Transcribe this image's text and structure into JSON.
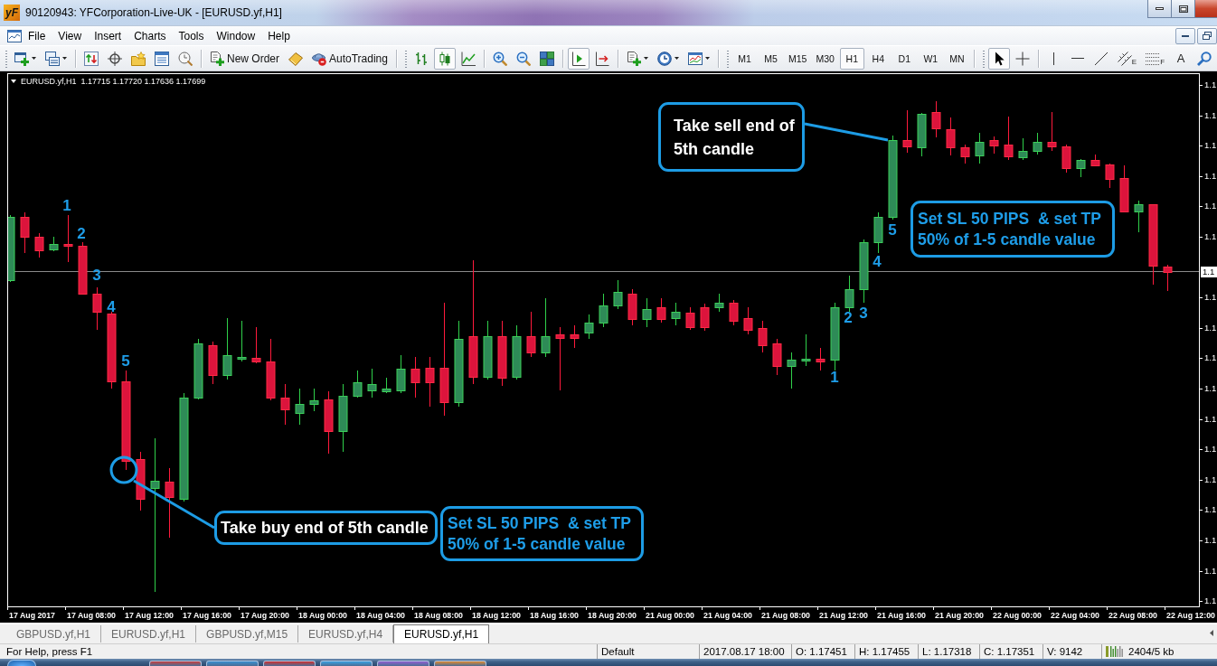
{
  "window": {
    "logo": "yF",
    "title": "90120943: YFCorporation-Live-UK - [EURUSD.yf,H1]"
  },
  "menu": [
    "File",
    "View",
    "Insert",
    "Charts",
    "Tools",
    "Window",
    "Help"
  ],
  "toolbar": {
    "bands": [
      [
        [
          {
            "kind": "new-chart",
            "dropdown": true,
            "selected": false
          },
          {
            "kind": "profiles",
            "dropdown": true,
            "selected": false
          }
        ],
        [
          {
            "kind": "market-watch",
            "selected": false
          },
          {
            "kind": "data-window",
            "selected": false
          },
          {
            "kind": "navigator",
            "selected": false
          },
          {
            "kind": "terminal",
            "selected": false
          },
          {
            "kind": "tester",
            "selected": false
          }
        ],
        [
          {
            "kind": "new-order",
            "label": "New Order",
            "selected": false
          },
          {
            "kind": "editor",
            "selected": false
          },
          {
            "kind": "autotrading",
            "label": "AutoTrading",
            "selected": false
          }
        ]
      ],
      [
        [
          {
            "kind": "bar-chart",
            "selected": false
          },
          {
            "kind": "candle-chart",
            "selected": true
          },
          {
            "kind": "line-chart",
            "selected": false
          }
        ],
        [
          {
            "kind": "zoom-in",
            "selected": false
          },
          {
            "kind": "zoom-out",
            "selected": false
          },
          {
            "kind": "tile",
            "selected": false
          }
        ],
        [
          {
            "kind": "chart-shift",
            "selected": true
          },
          {
            "kind": "autoscroll",
            "selected": false
          }
        ],
        [
          {
            "kind": "indicators",
            "dropdown": true,
            "selected": false
          },
          {
            "kind": "periods",
            "dropdown": true,
            "selected": false
          },
          {
            "kind": "templates",
            "dropdown": true,
            "selected": false
          }
        ]
      ],
      [
        [
          {
            "kind": "timeframe",
            "label": "M1",
            "selected": false
          },
          {
            "kind": "timeframe",
            "label": "M5",
            "selected": false
          },
          {
            "kind": "timeframe",
            "label": "M15",
            "selected": false
          },
          {
            "kind": "timeframe",
            "label": "M30",
            "selected": false
          },
          {
            "kind": "timeframe",
            "label": "H1",
            "selected": true
          },
          {
            "kind": "timeframe",
            "label": "H4",
            "selected": false
          },
          {
            "kind": "timeframe",
            "label": "D1",
            "selected": false
          },
          {
            "kind": "timeframe",
            "label": "W1",
            "selected": false
          },
          {
            "kind": "timeframe",
            "label": "MN",
            "selected": false
          }
        ]
      ],
      [
        [
          {
            "kind": "cursor",
            "selected": true
          },
          {
            "kind": "crosshair",
            "selected": false
          }
        ],
        [
          {
            "kind": "vline",
            "selected": false
          },
          {
            "kind": "hline",
            "selected": false
          },
          {
            "kind": "trendline",
            "selected": false
          },
          {
            "kind": "channel",
            "label": "E",
            "selected": false
          },
          {
            "kind": "fibo",
            "label": "F",
            "selected": false
          },
          {
            "kind": "text",
            "label": "A",
            "selected": false
          },
          {
            "kind": "search",
            "selected": false
          }
        ]
      ]
    ]
  },
  "chart": {
    "header": "EURUSD.yf,H1  1.17715 1.17720 1.17636 1.17699",
    "markers": [
      "1",
      "2",
      "3",
      "4",
      "5",
      "1",
      "2",
      "3",
      "4",
      "5"
    ],
    "callouts": [
      {
        "kind": "action",
        "text": "Take buy end of 5th candle"
      },
      {
        "kind": "rule",
        "text": "Set SL 50 PIPS  & set TP\n50% of 1-5 candle value"
      },
      {
        "kind": "action",
        "text": "Take sell end of\n5th candle"
      },
      {
        "kind": "rule",
        "text": "Set SL 50 PIPS  & set TP\n50% of 1-5 candle value"
      }
    ],
    "price_labels": [
      "1.1",
      "1.1",
      "1.1",
      "1.1",
      "1.1",
      "1.1",
      "1.1",
      "1.1",
      "1.1",
      "1.1",
      "1.1",
      "1.1",
      "1.1",
      "1.1",
      "1.1",
      "1.1",
      "1.1"
    ],
    "current_price": "1.1",
    "time_labels": [
      "17 Aug 2017",
      "17 Aug 08:00",
      "17 Aug 12:00",
      "17 Aug 16:00",
      "17 Aug 20:00",
      "18 Aug 00:00",
      "18 Aug 04:00",
      "18 Aug 08:00",
      "18 Aug 12:00",
      "18 Aug 16:00",
      "18 Aug 20:00",
      "21 Aug 00:00",
      "21 Aug 04:00",
      "21 Aug 08:00",
      "21 Aug 12:00",
      "21 Aug 16:00",
      "21 Aug 20:00",
      "22 Aug 00:00",
      "22 Aug 04:00",
      "22 Aug 08:00",
      "22 Aug 12:00"
    ]
  },
  "tabs": [
    {
      "label": "GBPUSD.yf,H1",
      "selected": false
    },
    {
      "label": "EURUSD.yf,H1",
      "selected": false
    },
    {
      "label": "GBPUSD.yf,M15",
      "selected": false
    },
    {
      "label": "EURUSD.yf,H4",
      "selected": false
    },
    {
      "label": "EURUSD.yf,H1",
      "selected": true
    }
  ],
  "status_bar": {
    "help": "For Help, press F1",
    "profile": "Default",
    "time": "2017.08.17 18:00",
    "open": "O: 1.17451",
    "high": "H: 1.17455",
    "low": "L: 1.17318",
    "close": "C: 1.17351",
    "volume": "V: 9142",
    "traffic": "2404/5 kb"
  }
}
